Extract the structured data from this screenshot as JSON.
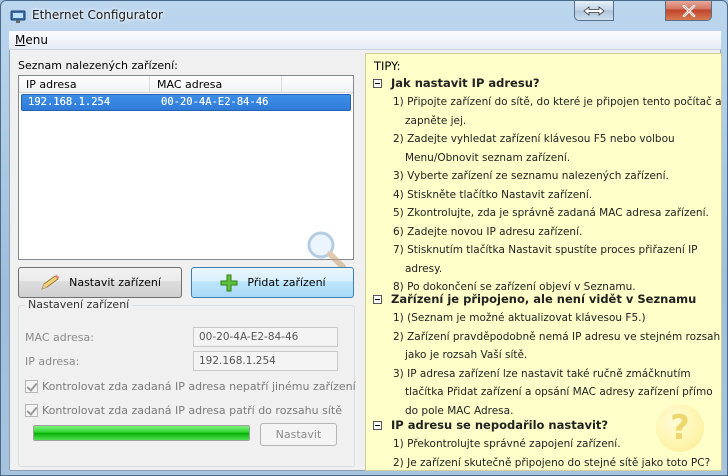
{
  "window": {
    "title": "Ethernet Configurator"
  },
  "menu": {
    "label": "Menu"
  },
  "devices": {
    "label": "Seznam nalezených zařízení:",
    "columns": [
      "IP adresa",
      "MAC adresa"
    ],
    "rows": [
      {
        "ip": "192.168.1.254",
        "mac": "00-20-4A-E2-84-46"
      }
    ]
  },
  "buttons": {
    "set_device": "Nastavit zařízení",
    "add_device": "Přidat zařízení",
    "apply": "Nastavit"
  },
  "settings": {
    "group_title": "Nastavení zařízení",
    "mac_label": "MAC adresa:",
    "mac_value": "00-20-4A-E2-84-46",
    "ip_label": "IP adresa:",
    "ip_value": "192.168.1.254",
    "check1": "Kontrolovat zda zadaná IP adresa nepatří jinému zařízení",
    "check2": "Kontrolovat zda zadaná IP adresa patří do rozsahu sítě",
    "progress": 1.0
  },
  "tips": {
    "title": "TIPY:",
    "sections": [
      {
        "heading": "Jak nastavit IP adresu?",
        "lines": [
          "1) Připojte zařízení do sítě, do které je připojen tento počítač a",
          "zapněte jej.",
          "2) Zadejte vyhledat zařízení klávesou F5 nebo volbou",
          "Menu/Obnovit seznam zařízení.",
          "3) Vyberte zařízení ze seznamu nalezených zařízení.",
          "4) Stiskněte tlačítko Nastavit zařízení.",
          "5) Zkontrolujte, zda je správně zadaná MAC adresa zařízení.",
          "6) Zadejte novou IP adresu zařízení.",
          "7) Stisknutím tlačítka Nastavit spustíte proces přiřazení IP",
          "adresy.",
          "8) Po dokončení se zařízení objeví v Seznamu."
        ]
      },
      {
        "heading": "Zařízení je připojeno, ale není vidět v Seznamu",
        "lines": [
          "1) (Seznam je možné aktualizovat klávesou F5.)",
          "2) Zařízení pravděpodobně nemá IP adresu ve stejném rozsahu",
          "jako je rozsah Vaší sítě.",
          "3) IP adresa zařízení lze nastavit také ručně zmáčknutím",
          "tlačítka Přidat zařízení a opsání MAC adresy zařízení přímo",
          "do pole MAC Adresa."
        ]
      },
      {
        "heading": "IP adresu se nepodařilo nastavit?",
        "lines": [
          "1) Překontrolujte správné zapojení zařízení.",
          "2) Je zařízení skutečně připojeno do stejné sítě jako toto PC?"
        ]
      }
    ]
  }
}
